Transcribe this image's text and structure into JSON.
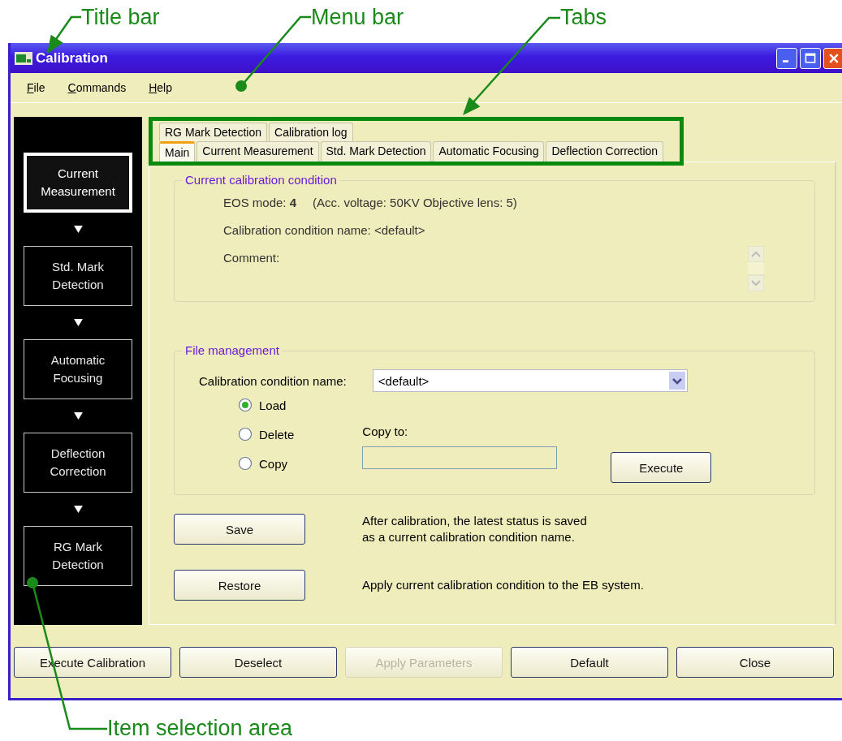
{
  "annotations": [
    {
      "label": "Title bar",
      "kind": "arrow"
    },
    {
      "label": "Menu bar",
      "kind": "dot"
    },
    {
      "label": "Tabs",
      "kind": "arrow"
    },
    {
      "label": "Item selection area",
      "kind": "dot"
    }
  ],
  "window": {
    "title": "Calibration"
  },
  "menu": [
    "File",
    "Commands",
    "Help"
  ],
  "sidebar": {
    "items": [
      {
        "label": "Current Measurement",
        "selected": true
      },
      {
        "label": "Std. Mark Detection",
        "selected": false
      },
      {
        "label": "Automatic Focusing",
        "selected": false
      },
      {
        "label": "Deflection Correction",
        "selected": false
      },
      {
        "label": "RG Mark Detection",
        "selected": false
      }
    ]
  },
  "tabs": {
    "row_1": [
      {
        "label": "RG Mark Detection",
        "selected": false
      },
      {
        "label": "Calibration log",
        "selected": false
      }
    ],
    "row_2": [
      {
        "label": "Main",
        "selected": true
      },
      {
        "label": "Current Measurement",
        "selected": false
      },
      {
        "label": "Std. Mark Detection",
        "selected": false
      },
      {
        "label": "Automatic Focusing",
        "selected": false
      },
      {
        "label": "Deflection Correction",
        "selected": false
      }
    ]
  },
  "current_condition": {
    "title": "Current calibration condition",
    "eos_mode": "EOS mode: **4**",
    "details": "(Acc. voltage: 50KV   Objective lens: 5)",
    "name_line": "Calibration condition name: <default>",
    "comment_label": "Comment:"
  },
  "file_management": {
    "title": "File management",
    "name_label": "Calibration condition name:",
    "name_value": "<default>",
    "options": [
      {
        "label": "Load",
        "selected": true
      },
      {
        "label": "Delete",
        "selected": false
      },
      {
        "label": "Copy",
        "selected": false
      }
    ],
    "copy_to_label": "Copy to:",
    "execute": "Execute"
  },
  "actions": [
    {
      "button": "Save",
      "text": "After calibration, the latest status is saved\nas a current calibration condition name."
    },
    {
      "button": "Restore",
      "text": "Apply current calibration condition to the EB system."
    }
  ],
  "buttons": [
    {
      "label": "Execute Calibration",
      "disabled": false
    },
    {
      "label": "Deselect",
      "disabled": false
    },
    {
      "label": "Apply Parameters",
      "disabled": true
    },
    {
      "label": "Default",
      "disabled": false
    },
    {
      "label": "Close",
      "disabled": false
    }
  ]
}
